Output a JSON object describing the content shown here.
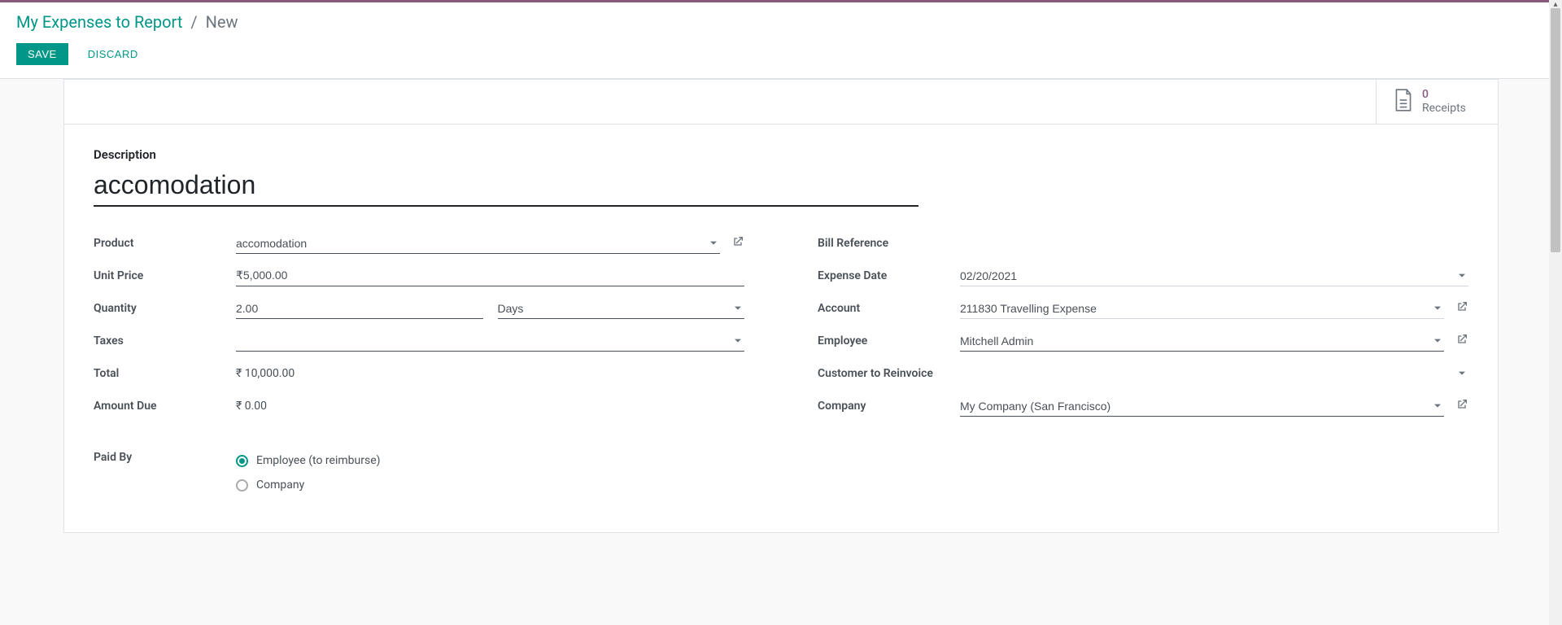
{
  "breadcrumb": {
    "parent": "My Expenses to Report",
    "separator": "/",
    "current": "New"
  },
  "actions": {
    "save": "SAVE",
    "discard": "DISCARD"
  },
  "receipts": {
    "count": "0",
    "label": "Receipts"
  },
  "description": {
    "label": "Description",
    "value": "accomodation"
  },
  "left": {
    "product": {
      "label": "Product",
      "value": "accomodation"
    },
    "unit_price": {
      "label": "Unit Price",
      "value": "₹5,000.00"
    },
    "quantity": {
      "label": "Quantity",
      "value": "2.00",
      "uom": "Days"
    },
    "taxes": {
      "label": "Taxes",
      "value": ""
    },
    "total": {
      "label": "Total",
      "value": "₹ 10,000.00"
    },
    "amount_due": {
      "label": "Amount Due",
      "value": "₹ 0.00"
    }
  },
  "right": {
    "bill_reference": {
      "label": "Bill Reference",
      "value": ""
    },
    "expense_date": {
      "label": "Expense Date",
      "value": "02/20/2021"
    },
    "account": {
      "label": "Account",
      "value": "211830 Travelling Expense"
    },
    "employee": {
      "label": "Employee",
      "value": "Mitchell Admin"
    },
    "customer_reinvoice": {
      "label": "Customer to Reinvoice",
      "value": ""
    },
    "company": {
      "label": "Company",
      "value": "My Company (San Francisco)"
    }
  },
  "paid_by": {
    "label": "Paid By",
    "options": {
      "employee": "Employee (to reimburse)",
      "company": "Company"
    }
  }
}
